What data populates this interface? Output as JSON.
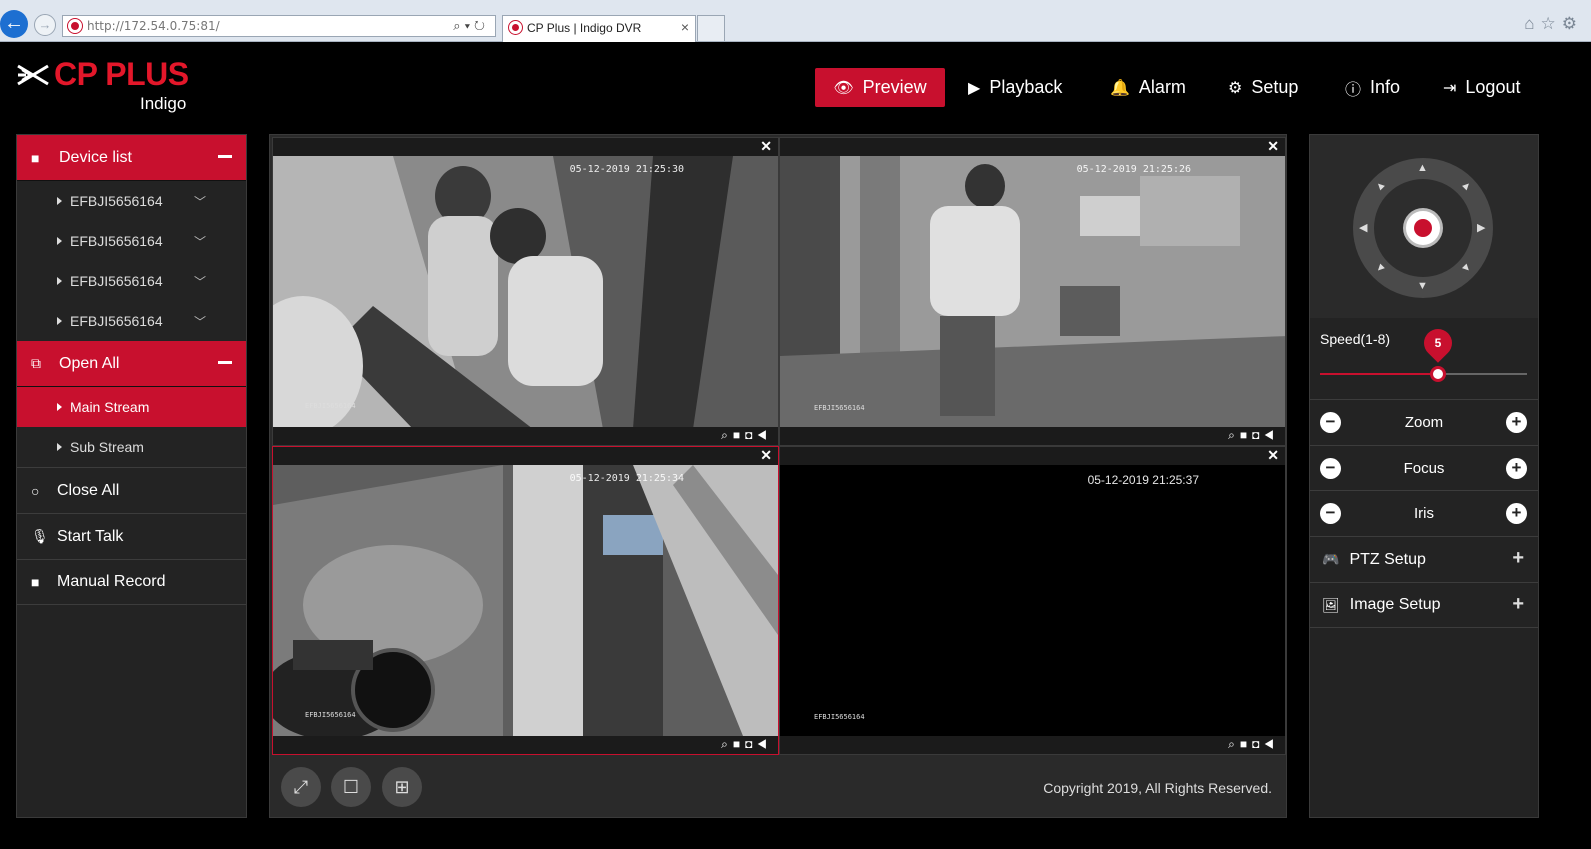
{
  "browser": {
    "url_host": "http://172.54.0.75",
    "url_port": ":81/",
    "tab_title": "CP Plus | Indigo DVR",
    "tab_close": "×"
  },
  "brand": {
    "name": "CP PLUS",
    "sub": "Indigo"
  },
  "nav": {
    "preview": "Preview",
    "playback": "Playback",
    "alarm": "Alarm",
    "setup": "Setup",
    "info": "Info",
    "logout": "Logout"
  },
  "sidebar": {
    "device_list": "Device list",
    "devices": [
      "EFBJI5656164",
      "EFBJI5656164",
      "EFBJI5656164",
      "EFBJI5656164"
    ],
    "open_all": "Open All",
    "main_stream": "Main Stream",
    "sub_stream": "Sub Stream",
    "close_all": "Close All",
    "start_talk": "Start Talk",
    "manual_record": "Manual Record"
  },
  "videos": [
    {
      "timestamp": "05-12-2019 21:25:30",
      "tag": "EFBJI5656164"
    },
    {
      "timestamp": "05-12-2019 21:25:26",
      "tag": "EFBJI5656164"
    },
    {
      "timestamp": "05-12-2019 21:25:34",
      "tag": "EFBJI5656164"
    },
    {
      "timestamp": "05-12-2019 21:25:37",
      "tag": "EFBJI5656164"
    }
  ],
  "footer": {
    "copyright": "Copyright 2019, All Rights Reserved."
  },
  "ptz": {
    "speed_label": "Speed(1-8)",
    "speed_value": 5,
    "speed_min": 1,
    "speed_max": 8,
    "zoom": "Zoom",
    "focus": "Focus",
    "iris": "Iris",
    "ptz_setup": "PTZ Setup",
    "image_setup": "Image Setup"
  },
  "colors": {
    "accent": "#c8102e",
    "panel": "#232323",
    "background": "#000000"
  }
}
